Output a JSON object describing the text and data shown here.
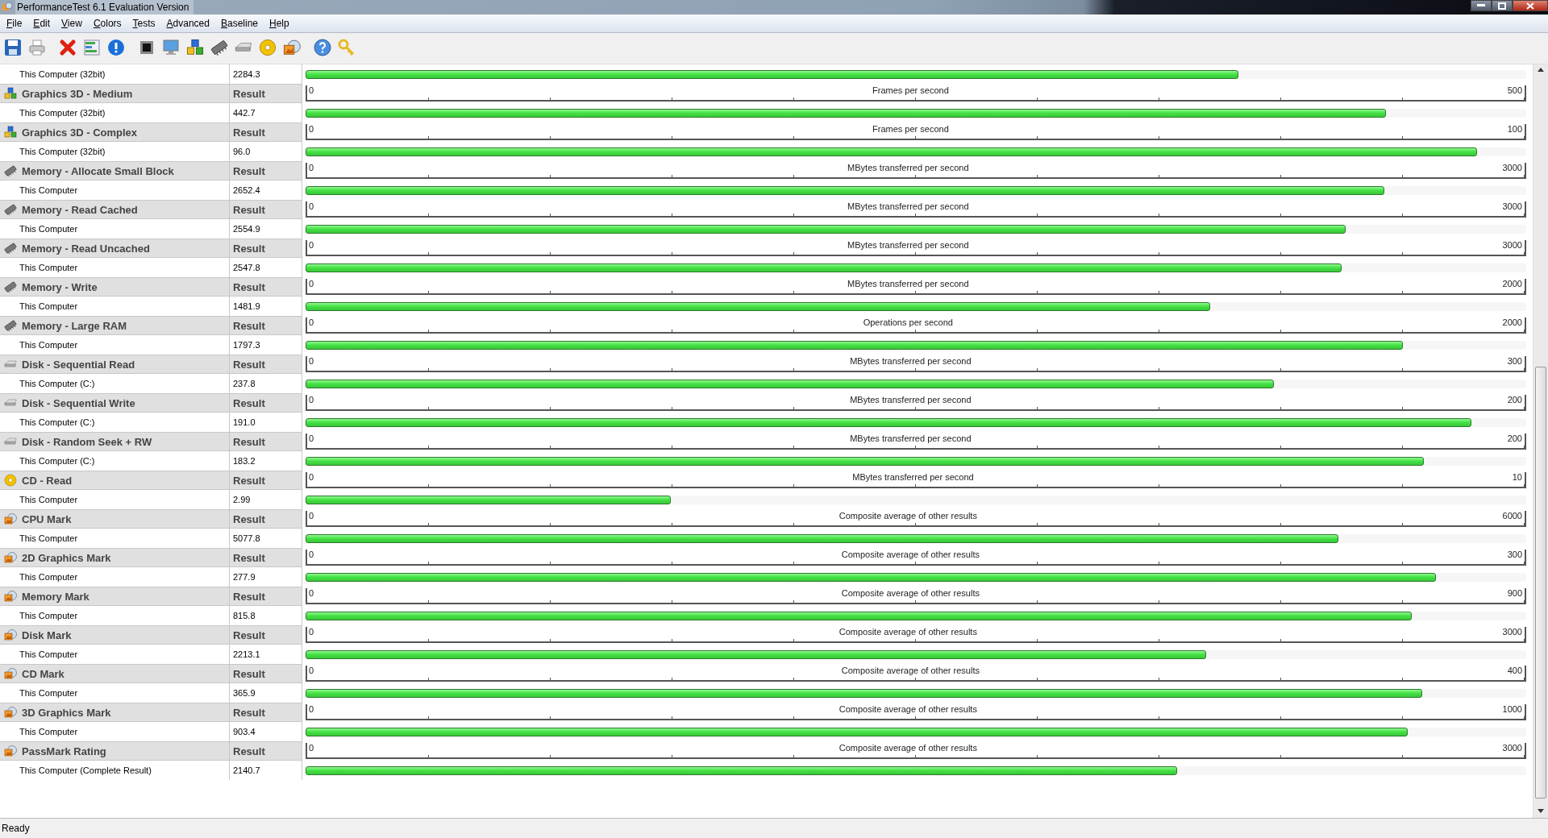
{
  "window": {
    "title": "PerformanceTest 6.1 Evaluation Version"
  },
  "menu": [
    "File",
    "Edit",
    "View",
    "Colors",
    "Tests",
    "Advanced",
    "Baseline",
    "Help"
  ],
  "rows": [
    {
      "kind": "result",
      "label": "This Computer (32bit)",
      "value": "2284.3",
      "level": 0.764
    },
    {
      "kind": "graphics3d",
      "name": "Graphics 3D - Medium",
      "column": "Result",
      "min": "0",
      "unit": "Frames per second",
      "max": "500"
    },
    {
      "kind": "result",
      "label": "This Computer (32bit)",
      "value": "442.7",
      "level": 0.885
    },
    {
      "kind": "graphics3d",
      "name": "Graphics 3D - Complex",
      "column": "Result",
      "min": "0",
      "unit": "Frames per second",
      "max": "100"
    },
    {
      "kind": "result",
      "label": "This Computer (32bit)",
      "value": "96.0",
      "level": 0.96
    },
    {
      "kind": "memory",
      "name": "Memory - Allocate Small Block",
      "column": "Result",
      "min": "0",
      "unit": "MBytes transferred per second",
      "max": "3000"
    },
    {
      "kind": "result",
      "label": "This Computer",
      "value": "2652.4",
      "level": 0.884
    },
    {
      "kind": "memory",
      "name": "Memory - Read Cached",
      "column": "Result",
      "min": "0",
      "unit": "MBytes transferred per second",
      "max": "3000"
    },
    {
      "kind": "result",
      "label": "This Computer",
      "value": "2554.9",
      "level": 0.852
    },
    {
      "kind": "memory",
      "name": "Memory - Read Uncached",
      "column": "Result",
      "min": "0",
      "unit": "MBytes transferred per second",
      "max": "3000"
    },
    {
      "kind": "result",
      "label": "This Computer",
      "value": "2547.8",
      "level": 0.849
    },
    {
      "kind": "memory",
      "name": "Memory - Write",
      "column": "Result",
      "min": "0",
      "unit": "MBytes transferred per second",
      "max": "2000"
    },
    {
      "kind": "result",
      "label": "This Computer",
      "value": "1481.9",
      "level": 0.741
    },
    {
      "kind": "memory",
      "name": "Memory - Large RAM",
      "column": "Result",
      "min": "0",
      "unit": "Operations per second",
      "max": "2000"
    },
    {
      "kind": "result",
      "label": "This Computer",
      "value": "1797.3",
      "level": 0.899
    },
    {
      "kind": "disk",
      "name": "Disk - Sequential Read",
      "column": "Result",
      "min": "0",
      "unit": "MBytes transferred per second",
      "max": "300"
    },
    {
      "kind": "result",
      "label": "This Computer (C:)",
      "value": "237.8",
      "level": 0.793
    },
    {
      "kind": "disk",
      "name": "Disk - Sequential Write",
      "column": "Result",
      "min": "0",
      "unit": "MBytes transferred per second",
      "max": "200"
    },
    {
      "kind": "result",
      "label": "This Computer (C:)",
      "value": "191.0",
      "level": 0.955
    },
    {
      "kind": "disk",
      "name": "Disk - Random Seek + RW",
      "column": "Result",
      "min": "0",
      "unit": "MBytes transferred per second",
      "max": "200"
    },
    {
      "kind": "result",
      "label": "This Computer (C:)",
      "value": "183.2",
      "level": 0.916
    },
    {
      "kind": "cd",
      "name": "CD - Read",
      "column": "Result",
      "min": "0",
      "unit": "MBytes transferred per second",
      "max": "10"
    },
    {
      "kind": "result",
      "label": "This Computer",
      "value": "2.99",
      "level": 0.299
    },
    {
      "kind": "mark",
      "name": "CPU Mark",
      "column": "Result",
      "min": "0",
      "unit": "Composite average of other results",
      "max": "6000"
    },
    {
      "kind": "result",
      "label": "This Computer",
      "value": "5077.8",
      "level": 0.846
    },
    {
      "kind": "mark",
      "name": "2D Graphics Mark",
      "column": "Result",
      "min": "0",
      "unit": "Composite average of other results",
      "max": "300"
    },
    {
      "kind": "result",
      "label": "This Computer",
      "value": "277.9",
      "level": 0.926
    },
    {
      "kind": "mark",
      "name": "Memory Mark",
      "column": "Result",
      "min": "0",
      "unit": "Composite average of other results",
      "max": "900"
    },
    {
      "kind": "result",
      "label": "This Computer",
      "value": "815.8",
      "level": 0.906
    },
    {
      "kind": "mark",
      "name": "Disk Mark",
      "column": "Result",
      "min": "0",
      "unit": "Composite average of other results",
      "max": "3000"
    },
    {
      "kind": "result",
      "label": "This Computer",
      "value": "2213.1",
      "level": 0.738
    },
    {
      "kind": "mark",
      "name": "CD Mark",
      "column": "Result",
      "min": "0",
      "unit": "Composite average of other results",
      "max": "400"
    },
    {
      "kind": "result",
      "label": "This Computer",
      "value": "365.9",
      "level": 0.915
    },
    {
      "kind": "mark",
      "name": "3D Graphics Mark",
      "column": "Result",
      "min": "0",
      "unit": "Composite average of other results",
      "max": "1000"
    },
    {
      "kind": "result",
      "label": "This Computer",
      "value": "903.4",
      "level": 0.903
    },
    {
      "kind": "mark",
      "name": "PassMark Rating",
      "column": "Result",
      "min": "0",
      "unit": "Composite average of other results",
      "max": "3000"
    },
    {
      "kind": "result",
      "label": "This Computer (Complete Result)",
      "value": "2140.7",
      "level": 0.714
    }
  ],
  "status_bar": {
    "text": "Ready"
  }
}
